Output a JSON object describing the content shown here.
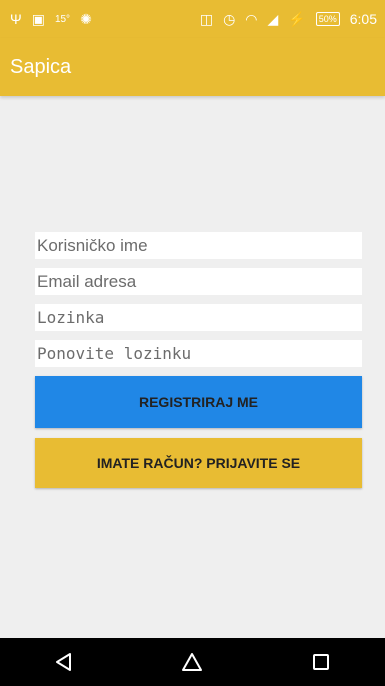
{
  "status_bar": {
    "temperature": "15°",
    "battery": "50%",
    "time": "6:05"
  },
  "app_bar": {
    "title": "Sapica"
  },
  "form": {
    "username_placeholder": "Korisničko ime",
    "email_placeholder": "Email adresa",
    "password_placeholder": "Lozinka",
    "repeat_password_placeholder": "Ponovite lozinku"
  },
  "buttons": {
    "register_label": "REGISTRIRAJ ME",
    "login_label": "IMATE RAČUN? PRIJAVITE SE"
  },
  "colors": {
    "primary": "#e8bc33",
    "accent_button": "#2087e6",
    "background": "#efefef"
  }
}
